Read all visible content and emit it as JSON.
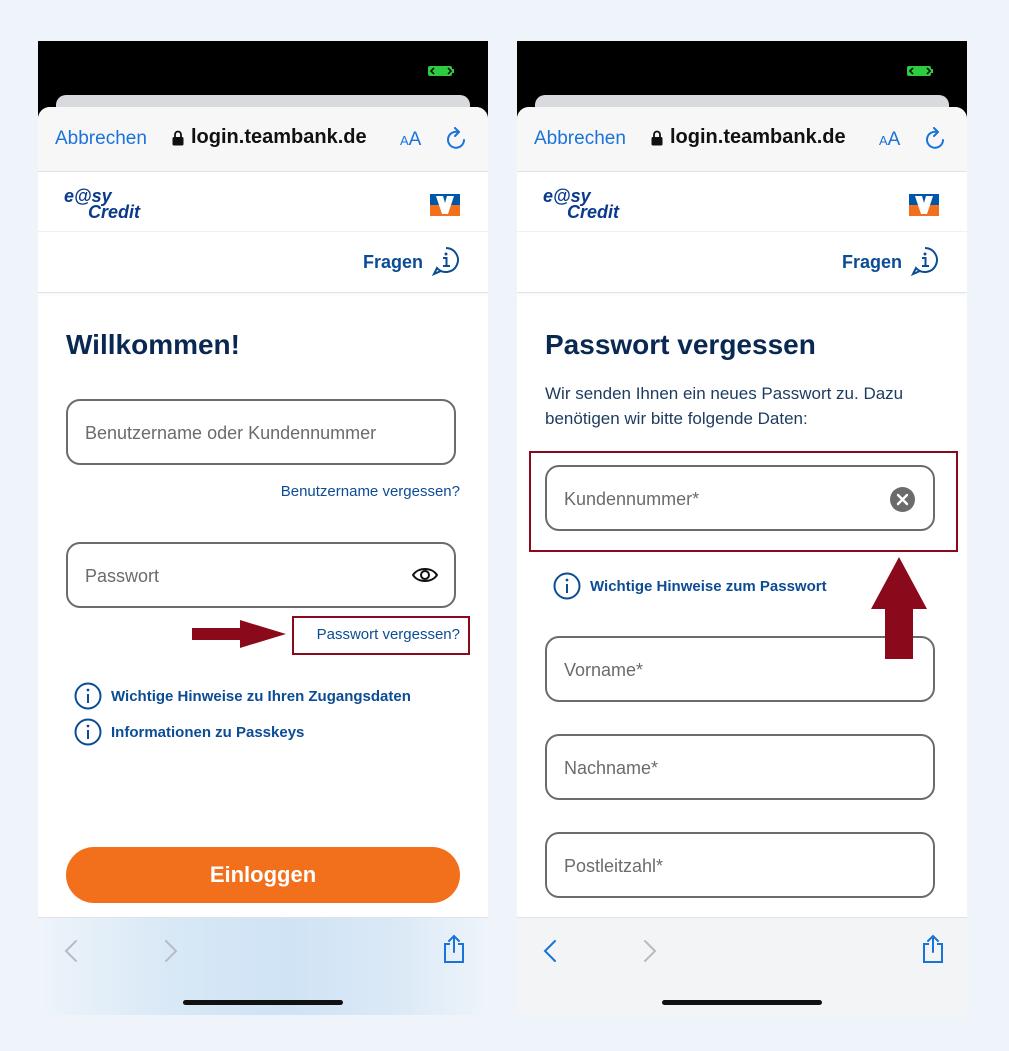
{
  "colors": {
    "accent_blue": "#1a73d9",
    "brand_blue": "#0c4c94",
    "title_navy": "#0a2952",
    "cta_orange": "#f26f1c",
    "annotation_red": "#8a0a1c"
  },
  "left": {
    "browser": {
      "cancel": "Abbrechen",
      "url": "login.teambank.de",
      "aa_small": "A",
      "aa_big": "A"
    },
    "brand": {
      "logo_line1": "e@sy",
      "logo_line2": "Credit"
    },
    "help": {
      "label": "Fragen"
    },
    "title": "Willkommen!",
    "username": {
      "placeholder": "Benutzername oder Kundennummer"
    },
    "forgot_username": "Benutzername vergessen?",
    "password": {
      "placeholder": "Passwort"
    },
    "forgot_password": "Passwort vergessen?",
    "info_links": [
      "Wichtige Hinweise zu Ihren Zugangsdaten",
      "Informationen zu Passkeys"
    ],
    "login_button": "Einloggen"
  },
  "right": {
    "browser": {
      "cancel": "Abbrechen",
      "url": "login.teambank.de",
      "aa_small": "A",
      "aa_big": "A"
    },
    "brand": {
      "logo_line1": "e@sy",
      "logo_line2": "Credit"
    },
    "help": {
      "label": "Fragen"
    },
    "title": "Passwort vergessen",
    "intro": "Wir senden Ihnen ein neues Passwort zu. Dazu benötigen wir bitte folgende Daten:",
    "customer_number": {
      "placeholder": "Kundennummer*"
    },
    "password_hint": "Wichtige Hinweise zum Passwort",
    "first_name": {
      "placeholder": "Vorname*"
    },
    "last_name": {
      "placeholder": "Nachname*"
    },
    "postal_code": {
      "placeholder": "Postleitzahl*"
    }
  }
}
